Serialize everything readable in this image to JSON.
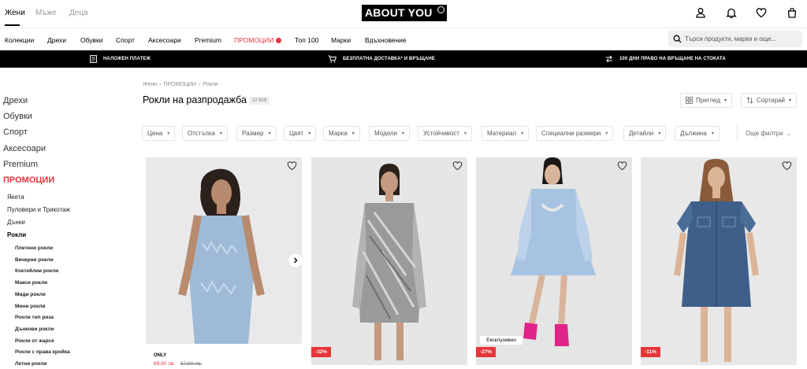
{
  "header": {
    "genders": [
      "Жени",
      "Мъже",
      "Деца"
    ],
    "logo": "ABOUT YOU"
  },
  "nav": {
    "items": [
      "Колекции",
      "Дрехи",
      "Обувки",
      "Спорт",
      "Аксесоари",
      "Premium",
      "ПРОМОЦИИ",
      "Топ 100",
      "Марки",
      "Вдъхновение"
    ],
    "search_placeholder": "Търси продукти, марки и още..."
  },
  "strip": {
    "items": [
      "НАЛОЖЕН ПЛАТЕЖ",
      "БЕЗПЛАТНА ДОСТАВКА* И ВРЪЩАНЕ",
      "100 ДНИ ПРАВО НА ВРЪЩАНЕ НА СТОКАТА"
    ]
  },
  "sidebar": {
    "top": [
      "Дрехи",
      "Обувки",
      "Спорт",
      "Аксесоари",
      "Premium",
      "ПРОМОЦИИ"
    ],
    "sub": [
      "Якета",
      "Пуловери и Трикотаж",
      "Дънки",
      "Рокли"
    ],
    "dresses": [
      "Плетени рокли",
      "Вечерни рокли",
      "Коктейлни рокли",
      "Макси рокли",
      "Миди рокли",
      "Мини рокли",
      "Рокли тип риза",
      "Дънкови рокли",
      "Рокли от жарсе",
      "Рокли с права кройка",
      "Летни рокли"
    ]
  },
  "main": {
    "breadcrumb": [
      "Жени",
      "ПРОМОЦИИ",
      "Рокли"
    ],
    "title": "Рокли на разпродажба",
    "count": "22 818",
    "view_label": "Преглед",
    "sort_label": "Сортирай",
    "filters": [
      "Цена",
      "Отстъпка",
      "Размер",
      "Цвят",
      "Марка",
      "Модели",
      "Устойчивост",
      "Материал",
      "Специални размери",
      "Детайли",
      "Дължина"
    ],
    "more_filters": "Още филтри"
  },
  "products": [
    {
      "brand": "ONLY",
      "price": "69,90 лв.",
      "old_price": "87,90 лв.",
      "badge": ""
    },
    {
      "badge": "-32%"
    },
    {
      "badge": "-27%",
      "label": "Ексклузивно"
    },
    {
      "badge": "-11%"
    }
  ],
  "colors": {
    "accent": "#e6353a",
    "strip": "#000000"
  }
}
